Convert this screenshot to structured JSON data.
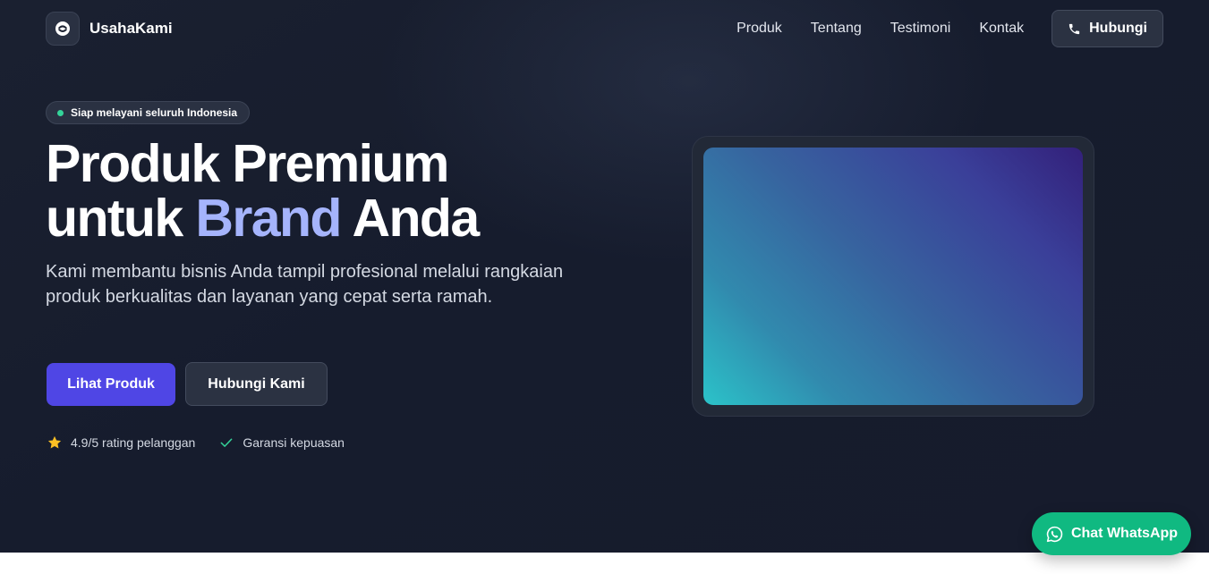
{
  "brand": {
    "name": "UsahaKami",
    "logo_icon": "smile-icon"
  },
  "nav": {
    "links": [
      "Produk",
      "Tentang",
      "Testimoni",
      "Kontak"
    ],
    "cta_label": "Hubungi",
    "cta_icon": "phone-icon"
  },
  "hero": {
    "badge": "Siap melayani seluruh Indonesia",
    "headline_line1": "Produk Premium",
    "headline_line2_prefix": "untuk ",
    "headline_accent": "Brand",
    "headline_line2_suffix": " Anda",
    "subtext": "Kami membantu bisnis Anda tampil profesional melalui rangkaian produk berkualitas dan layanan yang cepat serta ramah.",
    "primary_cta": "Lihat Produk",
    "secondary_cta": "Hubungi Kami",
    "trust": [
      {
        "icon": "star-icon",
        "text": "4.9/5 rating pelanggan"
      },
      {
        "icon": "check-icon",
        "text": "Garansi kepuasan"
      }
    ]
  },
  "whatsapp": {
    "label": "Chat WhatsApp",
    "icon": "whatsapp-icon"
  },
  "colors": {
    "hero_bg": "#161c2d",
    "accent": "#4f46e5",
    "accent_text": "#a5b4fc",
    "success": "#10b981",
    "status_dot": "#34d399",
    "star": "#fbbf24"
  }
}
